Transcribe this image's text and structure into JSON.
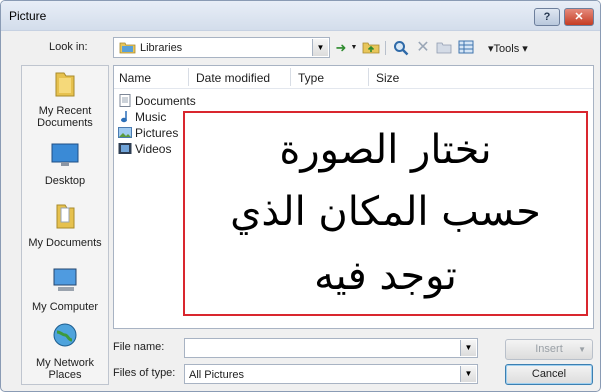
{
  "dialog": {
    "title": "Picture",
    "help_label": "?",
    "close_label": "✕"
  },
  "toolbar": {
    "lookin_label": "Look in:",
    "lookin_value": "Libraries",
    "tools_label": "Tools"
  },
  "places": [
    {
      "label": "My Recent Documents",
      "icon": "recent-documents-folder-icon"
    },
    {
      "label": "Desktop",
      "icon": "desktop-icon"
    },
    {
      "label": "My Documents",
      "icon": "my-documents-folder-icon"
    },
    {
      "label": "My Computer",
      "icon": "computer-icon"
    },
    {
      "label": "My Network Places",
      "icon": "network-globe-icon"
    }
  ],
  "filelist": {
    "columns": [
      "Name",
      "Date modified",
      "Type",
      "Size"
    ],
    "items": [
      {
        "name": "Documents",
        "icon": "documents-library-icon"
      },
      {
        "name": "Music",
        "icon": "music-library-icon"
      },
      {
        "name": "Pictures",
        "icon": "pictures-library-icon"
      },
      {
        "name": "Videos",
        "icon": "videos-library-icon"
      }
    ]
  },
  "annotation": {
    "lines": [
      "نختار الصورة",
      "حسب المكان الذي",
      "توجد فيه"
    ],
    "border_color": "#d9262e"
  },
  "footer": {
    "filename_label": "File name:",
    "filename_value": "",
    "filetype_label": "Files of type:",
    "filetype_value": "All Pictures",
    "insert_label": "Insert",
    "cancel_label": "Cancel"
  }
}
